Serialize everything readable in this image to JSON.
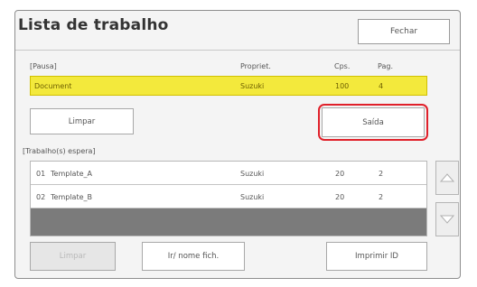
{
  "window": {
    "title": "Lista de trabalho",
    "close_label": "Fechar"
  },
  "paused": {
    "heading": "[Pausa]",
    "columns": [
      "Propriet.",
      "Cps.",
      "Pag."
    ],
    "job": {
      "name": "Document",
      "owner": "Suzuki",
      "copies": "100",
      "pages": "4"
    }
  },
  "actions": {
    "clear_label": "Limpar",
    "output_label": "Saída"
  },
  "waiting": {
    "heading": "[Trabalho(s) espera]",
    "rows": [
      {
        "index": "01",
        "name": "Template_A",
        "owner": "Suzuki",
        "copies": "20",
        "pages": "2"
      },
      {
        "index": "02",
        "name": "Template_B",
        "owner": "Suzuki",
        "copies": "20",
        "pages": "2"
      }
    ]
  },
  "footer": {
    "clear_label": "Limpar",
    "save_label": "Ir/ nome fich.",
    "print_label": "Imprimir ID"
  },
  "colors": {
    "selected_row": "#f3e93c",
    "highlight_border": "#e0202a",
    "empty_row": "#7b7b7b"
  },
  "icons": {
    "scroll_up": "triangle-up-icon",
    "scroll_down": "triangle-down-icon"
  }
}
